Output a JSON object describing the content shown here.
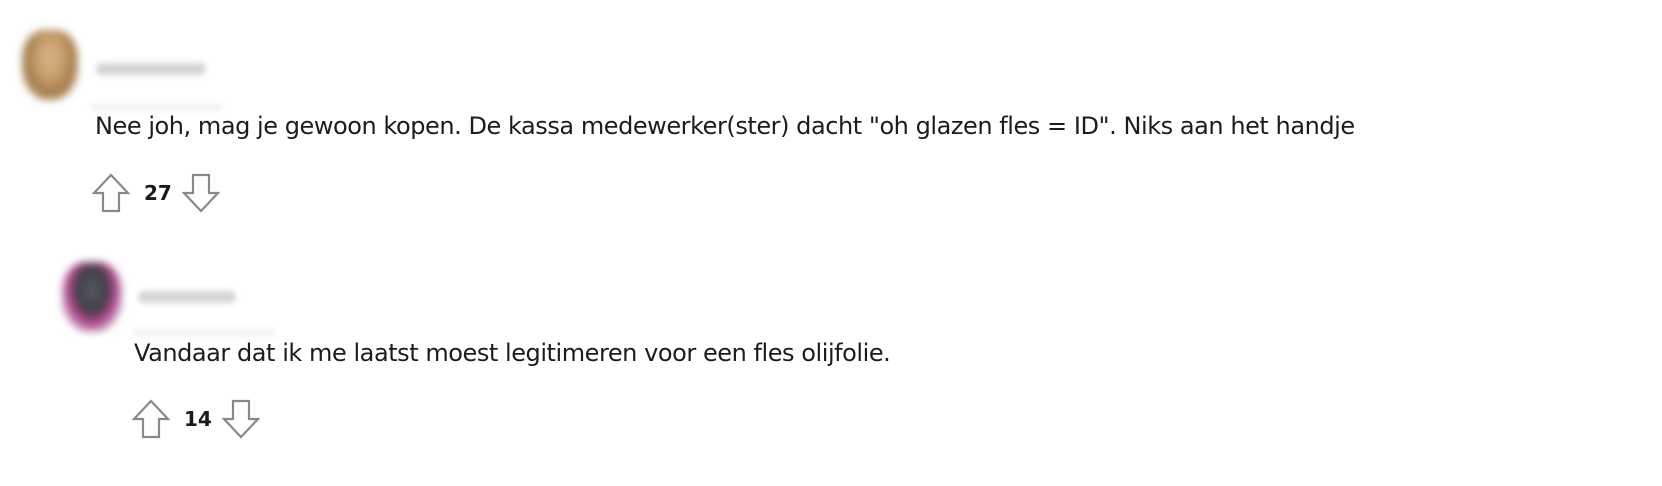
{
  "comments": [
    {
      "avatar_icon": "user-avatar-icon",
      "username": "",
      "text": "Nee joh, mag je gewoon kopen. De kassa medewerker(ster) dacht \"oh glazen fles = ID\". Niks aan het handje",
      "score": "27"
    },
    {
      "avatar_icon": "user-avatar-icon",
      "username": "",
      "text": "Vandaar dat ik me laatst moest legitimeren voor een fles olijfolie.",
      "score": "14"
    }
  ],
  "icons": {
    "upvote": "arrow-up-outline-icon",
    "downvote": "arrow-down-outline-icon"
  },
  "colors": {
    "text": "#1c1c1c",
    "icon_stroke": "#878a8c",
    "background": "#ffffff"
  }
}
